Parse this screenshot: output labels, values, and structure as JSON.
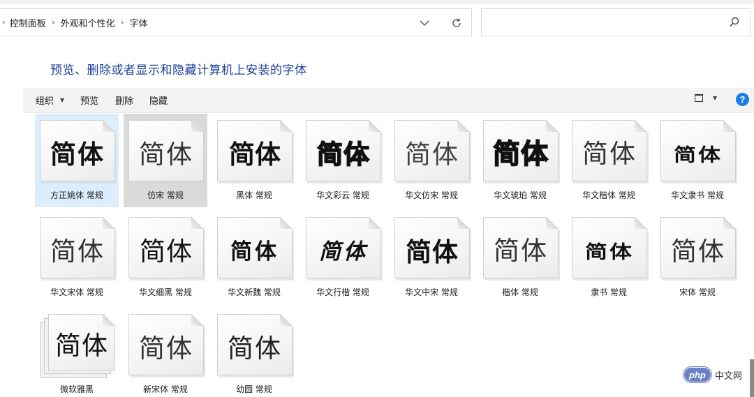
{
  "address": {
    "crumbs": [
      "控制面板",
      "外观和个性化",
      "字体"
    ]
  },
  "page": {
    "title": "预览、删除或者显示和隐藏计算机上安装的字体"
  },
  "toolbar": {
    "organize": "组织",
    "preview": "预览",
    "delete": "删除",
    "hide": "隐藏",
    "help": "?"
  },
  "fonts": {
    "sample_text": "简体",
    "items": [
      {
        "label": "方正姚体 常规"
      },
      {
        "label": "仿宋 常规"
      },
      {
        "label": "黑体 常规"
      },
      {
        "label": "华文彩云 常规"
      },
      {
        "label": "华文仿宋 常规"
      },
      {
        "label": "华文琥珀 常规"
      },
      {
        "label": "华文楷体 常规"
      },
      {
        "label": "华文隶书 常规"
      },
      {
        "label": "华文宋体 常规"
      },
      {
        "label": "华文细黑 常规"
      },
      {
        "label": "华文新魏 常规"
      },
      {
        "label": "华文行楷 常规"
      },
      {
        "label": "华文中宋 常规"
      },
      {
        "label": "楷体 常规"
      },
      {
        "label": "隶书 常规"
      },
      {
        "label": "宋体 常规"
      },
      {
        "label": "微软雅黑"
      },
      {
        "label": "新宋体 常规"
      },
      {
        "label": "幼圆 常规"
      }
    ]
  },
  "watermark": {
    "logo": "php",
    "text": "中文网"
  }
}
